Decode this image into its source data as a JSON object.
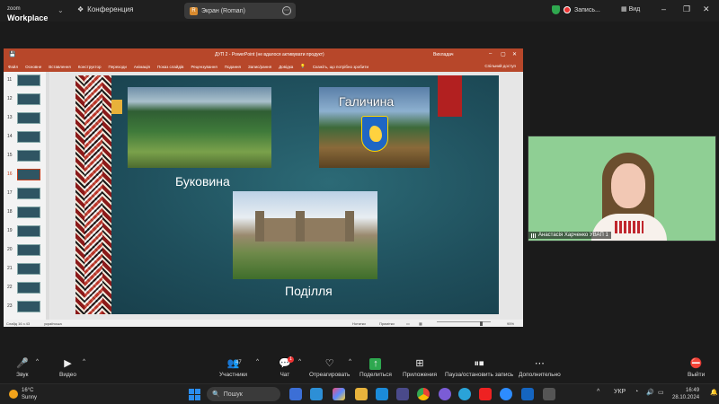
{
  "window": {
    "brand_line1": "zoom",
    "brand_line2": "Workplace",
    "conference_label": "Конференция",
    "screen_share_label": "Экран (Roman)",
    "screen_share_icon": "R",
    "recording_label": "Запись...",
    "view_label": "Вид"
  },
  "powerpoint": {
    "title": "ДУП 2 - PowerPoint (не вдалося активувати продукт)",
    "user": "Вихладач",
    "menu": [
      "Файл",
      "Основне",
      "Вставлення",
      "Конструктор",
      "Переходи",
      "Анімація",
      "Показ слайдів",
      "Рецензування",
      "Подання",
      "Запис/рання",
      "Довідка",
      "Скажіть, що потрібно зробити"
    ],
    "share": "Спільний доступ",
    "thumbnails": [
      "11",
      "12",
      "13",
      "14",
      "15",
      "16",
      "17",
      "18",
      "19",
      "20",
      "21",
      "22",
      "23"
    ],
    "selected_thumbnail": "16",
    "status_left": "Слайд 16 з 43",
    "status_lang": "українська",
    "status_notes": "Нотатки",
    "status_comments": "Примітки",
    "zoom_level": "95%"
  },
  "slide": {
    "label_bukovyna": "Буковина",
    "label_halychyna": "Галичина",
    "label_podillia": "Поділля"
  },
  "video": {
    "participant_name": "Анастасія Харченко УВАП 1"
  },
  "controls": {
    "sound": "Звук",
    "video": "Видео",
    "participants": "Участники",
    "participants_count": "47",
    "chat": "Чат",
    "chat_badge": "1",
    "react": "Отреагировать",
    "share": "Поделиться",
    "apps": "Приложения",
    "pause_recording": "Пауза/остановить запись",
    "more": "Дополнительно",
    "exit": "Выйти"
  },
  "taskbar": {
    "temperature": "16°C",
    "weather": "Sunny",
    "search": "Пошук",
    "language": "УКР",
    "time": "16:49",
    "date": "28.10.2024"
  },
  "colors": {
    "ppt_accent": "#b7472a",
    "slide_bg": "#1f4f5c",
    "recording": "#e33333",
    "zoom_bg": "#1b1b1b"
  }
}
